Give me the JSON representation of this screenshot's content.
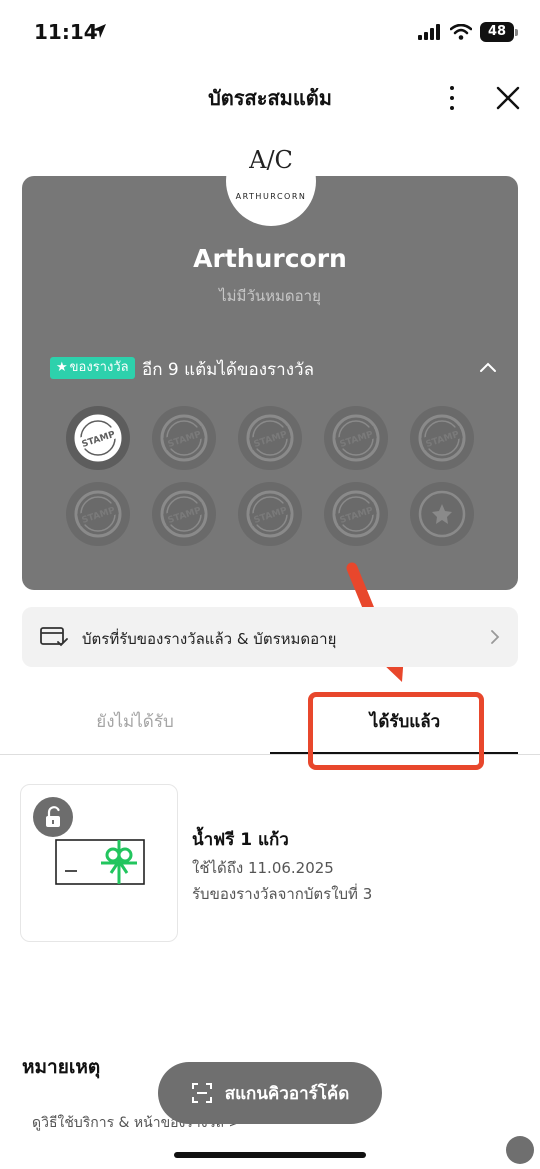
{
  "status_bar": {
    "time": "11:14",
    "battery": "48"
  },
  "header": {
    "title": "บัตรสะสมแต้ม"
  },
  "card": {
    "logo_mark": "A/C",
    "logo_text": "ARTHURCORN",
    "brand_name": "Arthurcorn",
    "expiry": "ไม่มีวันหมดอายุ",
    "reward_badge": "ของรางวัล",
    "reward_progress_text": "อีก 9 แต้มได้ของรางวัล",
    "stamps_total": 10,
    "stamps_collected": 1,
    "stamp_label": "STAMP"
  },
  "history": {
    "label": "บัตรที่รับของรางวัลแล้ว & บัตรหมดอายุ"
  },
  "tabs": {
    "pending": "ยังไม่ได้รับ",
    "received": "ได้รับแล้ว",
    "active": "received"
  },
  "reward": {
    "title": "น้ำฟรี 1 แก้ว",
    "valid_until": "ใช้ได้ถึง 11.06.2025",
    "source": "รับของรางวัลจากบัตรใบที่ 3"
  },
  "notes": {
    "title": "หมายเหตุ",
    "link": "ดูวิธีใช้บริการ & หน้าของรางวัล >"
  },
  "scan_button": {
    "label": "สแกนคิวอาร์โค้ด"
  },
  "colors": {
    "card_bg": "#777777",
    "badge": "#2dd1ac",
    "annotation": "#e8472c",
    "gift_ribbon": "#22c55e"
  }
}
